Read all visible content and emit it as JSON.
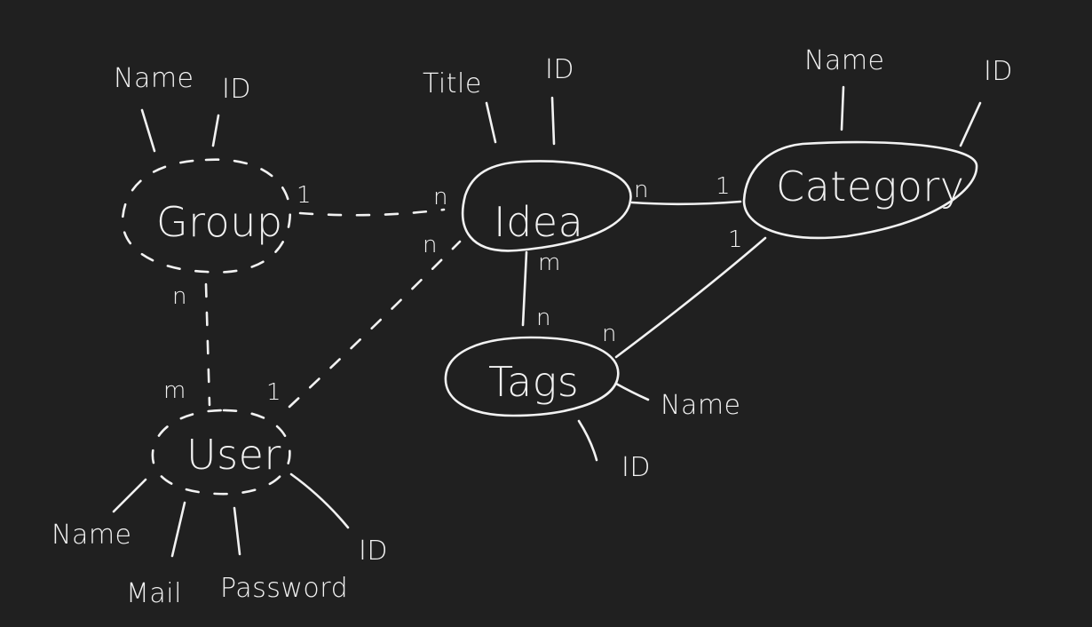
{
  "entities": {
    "group": {
      "label": "Group",
      "attrs": {
        "name": "Name",
        "id": "ID"
      }
    },
    "idea": {
      "label": "Idea",
      "attrs": {
        "title": "Title",
        "id": "ID"
      }
    },
    "category": {
      "label": "Category",
      "attrs": {
        "name": "Name",
        "id": "ID"
      }
    },
    "tags": {
      "label": "Tags",
      "attrs": {
        "name": "Name",
        "id": "ID"
      }
    },
    "user": {
      "label": "User",
      "attrs": {
        "name": "Name",
        "mail": "Mail",
        "password": "Password",
        "id": "ID"
      }
    }
  },
  "relationships": {
    "group_idea": {
      "group_end": "1",
      "idea_end": "n"
    },
    "group_user": {
      "group_end": "n",
      "user_end": "m"
    },
    "user_idea": {
      "user_end": "1",
      "idea_end": "n"
    },
    "idea_category": {
      "idea_end": "n",
      "category_end": "1"
    },
    "idea_tags": {
      "idea_end": "m",
      "tags_end": "n"
    },
    "tags_category": {
      "tags_end": "n",
      "category_end": "1"
    }
  }
}
